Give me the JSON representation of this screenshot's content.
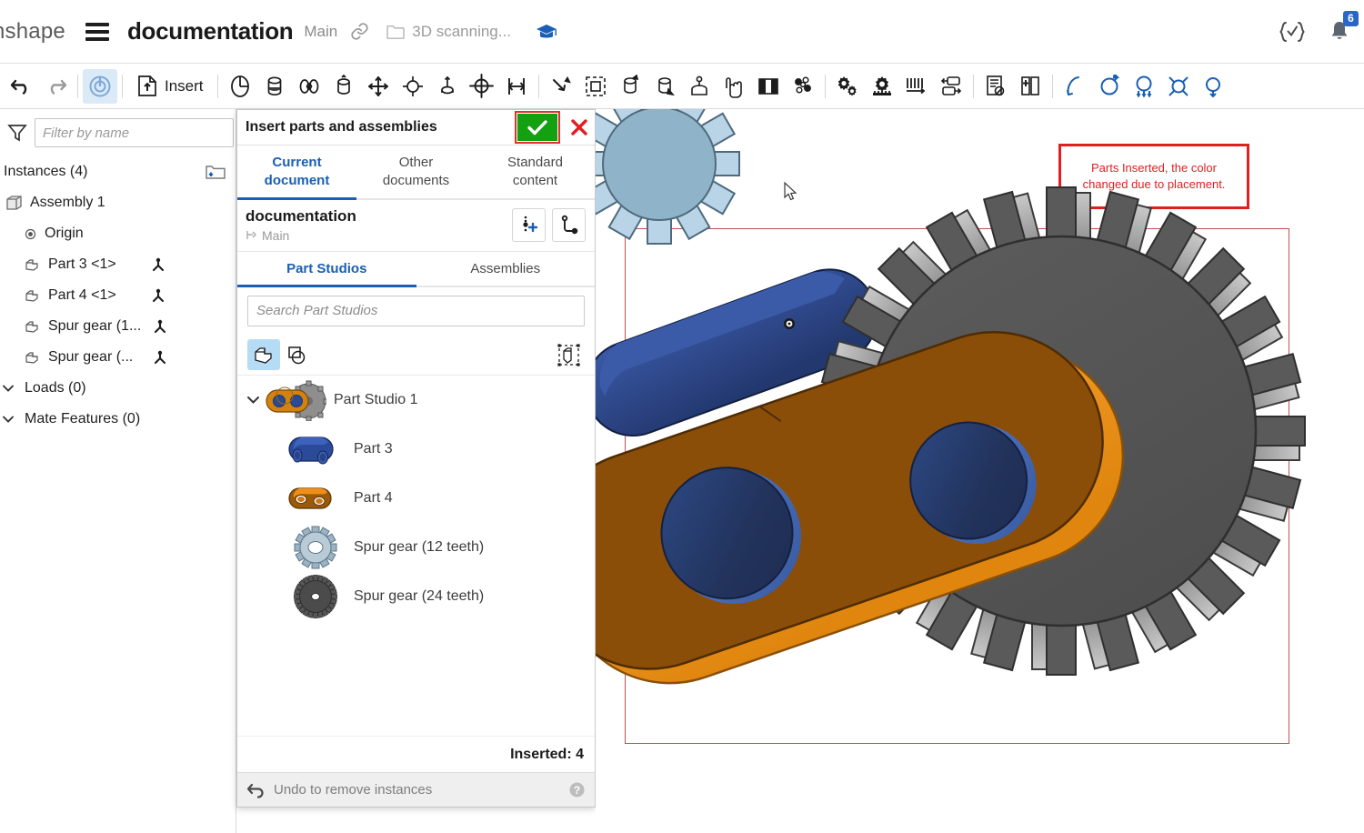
{
  "header": {
    "brand": "nshape",
    "menu_icon": "hamburger-icon",
    "document_title": "documentation",
    "workspace": "Main",
    "link_icon": "link-icon",
    "folder_icon": "folder-icon",
    "folder_label": "3D scanning...",
    "learning_icon": "graduation-cap-icon",
    "featurescript_icon": "featurescript-icon",
    "notifications_icon": "bell-icon",
    "notifications_count": "6"
  },
  "toolbar": {
    "undo": "Undo",
    "redo": "Redo",
    "mate_connector": "Mate connector",
    "insert_label": "Insert",
    "items": [
      "revolute-mate",
      "cylindrical-mate",
      "slider-mate",
      "planar-mate",
      "pin-slot-mate",
      "ball-mate",
      "parallel-mate",
      "tangent-mate",
      "fastened-mate",
      "group",
      "replicate",
      "mate-relation",
      "gear-relation",
      "rack-pinion",
      "screw-relation",
      "linear-relation",
      "cam-relation",
      "explode",
      "bom",
      "measure",
      "mass-properties",
      "section-view",
      "display-state",
      "transform",
      "pattern",
      "mirror"
    ]
  },
  "sidebar": {
    "filter_icon": "funnel-icon",
    "filter_placeholder": "Filter by name",
    "list_view_icon": "list-view-icon",
    "instances_header": "Instances (4)",
    "new_folder_icon": "new-folder-icon",
    "tree": [
      {
        "label": "Assembly 1",
        "icon": "assembly-icon",
        "indent": 0,
        "mate": false
      },
      {
        "label": "Origin",
        "icon": "origin-icon",
        "indent": 1,
        "mate": false
      },
      {
        "label": "Part 3 <1>",
        "icon": "part-icon",
        "indent": 1,
        "mate": true
      },
      {
        "label": "Part 4 <1>",
        "icon": "part-icon",
        "indent": 1,
        "mate": true
      },
      {
        "label": "Spur gear (1...",
        "icon": "part-icon",
        "indent": 1,
        "mate": true
      },
      {
        "label": "Spur gear (...",
        "icon": "part-icon",
        "indent": 1,
        "mate": true
      }
    ],
    "groups": [
      {
        "label": "Loads (0)"
      },
      {
        "label": "Mate Features (0)"
      }
    ]
  },
  "dialog": {
    "title": "Insert parts and assemblies",
    "accept_icon": "check-icon",
    "cancel_icon": "close-icon",
    "accept_highlight_color": "#e03030",
    "accept_color": "#13a011",
    "cancel_color": "#e02020",
    "source_tabs": [
      {
        "line1": "Current",
        "line2": "document",
        "active": true
      },
      {
        "line1": "Other",
        "line2": "documents",
        "active": false
      },
      {
        "line1": "Standard",
        "line2": "content",
        "active": false
      }
    ],
    "document_name": "documentation",
    "branch_icon": "branch-icon",
    "branch_label": "Main",
    "version_button_icon": "insert-version-icon",
    "branch_button_icon": "branch-graph-icon",
    "type_tabs": [
      {
        "label": "Part Studios",
        "active": true
      },
      {
        "label": "Assemblies",
        "active": false
      }
    ],
    "search_placeholder": "Search Part Studios",
    "filter_buttons": [
      {
        "icon": "solid-part-icon",
        "active": true
      },
      {
        "icon": "composite-part-icon",
        "active": false
      }
    ],
    "bounding_box_icon": "bounding-box-icon",
    "items": [
      {
        "name": "Part Studio 1",
        "thumb": "part-studio",
        "child": false,
        "expanded": true
      },
      {
        "name": "Part 3",
        "thumb": "part3-blue-link",
        "child": true
      },
      {
        "name": "Part 4",
        "thumb": "part4-orange-link",
        "child": true
      },
      {
        "name": "Spur gear (12 teeth)",
        "thumb": "gear-12",
        "child": true
      },
      {
        "name": "Spur gear (24 teeth)",
        "thumb": "gear-24",
        "child": true
      }
    ],
    "inserted_label": "Inserted: 4",
    "undo_icon": "undo-arrow-icon",
    "undo_label": "Undo to remove instances",
    "help_icon": "help-icon"
  },
  "viewport": {
    "annotation": "Parts Inserted, the color changed due to placement.",
    "annotation_color": "#e02020",
    "selection_box_color": "#c05050",
    "cursor_icon": "mouse-cursor",
    "model": {
      "link_body_color": "#8a4e09",
      "link_edge_color": "#ed8f1c",
      "pin_color": "#22335c",
      "pin_rim_color": "#3e63a8",
      "blue_part_color": "#2a4a96",
      "gear_color": "#575757",
      "gear_tooth_color": "#a8a8a8",
      "small_gear_color": "#b8d4e6"
    }
  }
}
